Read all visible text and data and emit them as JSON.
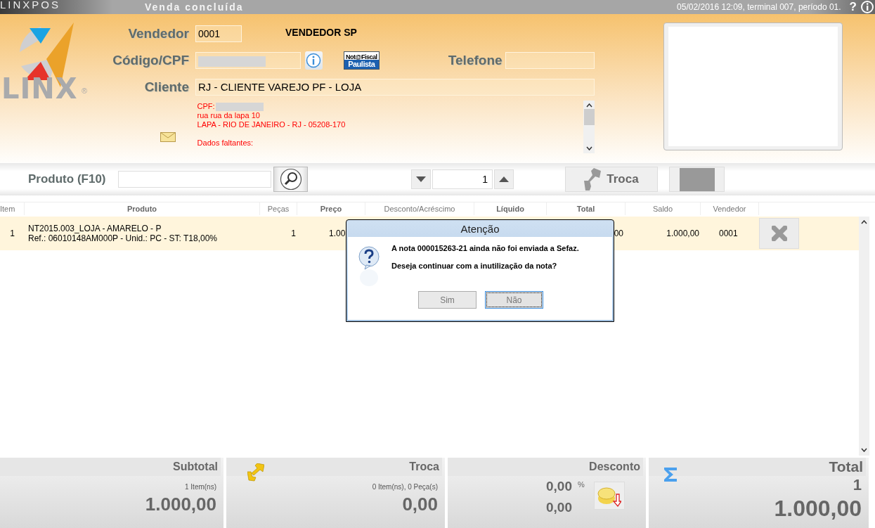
{
  "title_bar": {
    "brand": "LINXPOS",
    "title": "Venda concluída",
    "status": "05/02/2016 12:09, terminal 007, período 01.",
    "help": "?"
  },
  "logo": {
    "text": "LINX",
    "mark": "®"
  },
  "form": {
    "vendedor": {
      "label": "Vendedor",
      "value": "0001",
      "name": "VENDEDOR SP"
    },
    "codigo": {
      "label": "Código/CPF",
      "redacted": true
    },
    "nfp_badge": {
      "line_1": "Not@Fiscal",
      "line_2": "Paulista"
    },
    "telefone": {
      "label": "Telefone"
    },
    "cliente": {
      "label": "Cliente",
      "value": "RJ - CLIENTE VAREJO PF - LOJA"
    },
    "info_lines": [
      {
        "kind": "masked",
        "text": "CPF:"
      },
      {
        "kind": "line",
        "text": "rua rua da lapa 10"
      },
      {
        "kind": "line",
        "text": "LAPA - RIO DE JANEIRO - RJ - 05208-170"
      },
      {
        "kind": "spacer"
      },
      {
        "kind": "line",
        "text": "Dados faltantes:"
      }
    ]
  },
  "product_bar": {
    "label": "Produto (F10)",
    "quantity": "1",
    "troca_button": {
      "label": "Troca"
    }
  },
  "table": {
    "columns": [
      {
        "label": "Item",
        "bold": false
      },
      {
        "label": "Produto",
        "bold": true
      },
      {
        "label": "Peças",
        "bold": false
      },
      {
        "label": "Preço",
        "bold": true
      },
      {
        "label": "Desconto/Acréscimo",
        "bold": false
      },
      {
        "label": "Líquido",
        "bold": true
      },
      {
        "label": "Total",
        "bold": true
      },
      {
        "label": "Saldo",
        "bold": false
      },
      {
        "label": "Vendedor",
        "bold": false
      }
    ],
    "rows": [
      {
        "item": "1",
        "product_line_1": "NT2015.003_LOJA - AMARELO - P",
        "product_line_2": "Ref.: 06010148AM000P - Unid.: PC - ST: T18,00%",
        "pecas": "1",
        "preco": "1.00",
        "total": "00",
        "saldo": "1.000,00",
        "vendedor": "0001",
        "selected": true
      }
    ]
  },
  "dialog": {
    "title": "Atenção",
    "message_1": "A nota 000015263-21 ainda não foi enviada a Sefaz.",
    "message_2": "Deseja continuar com a inutilização da nota?",
    "buttons": [
      {
        "label": "Sim",
        "focused": false
      },
      {
        "label": "Não",
        "focused": true
      }
    ]
  },
  "totals": [
    {
      "kind": "subtotal",
      "label": "Subtotal",
      "detail": "1 Item(ns)",
      "value": "1.000,00"
    },
    {
      "kind": "troca",
      "label": "Troca",
      "detail": "0 Item(ns), 0 Peça(s)",
      "value": "0,00"
    },
    {
      "kind": "desconto",
      "label": "Desconto",
      "percent": "0,00",
      "percent_sign": "%",
      "value": "0,00"
    },
    {
      "kind": "total",
      "label": "Total",
      "count": "1",
      "value": "1.000,00"
    }
  ]
}
